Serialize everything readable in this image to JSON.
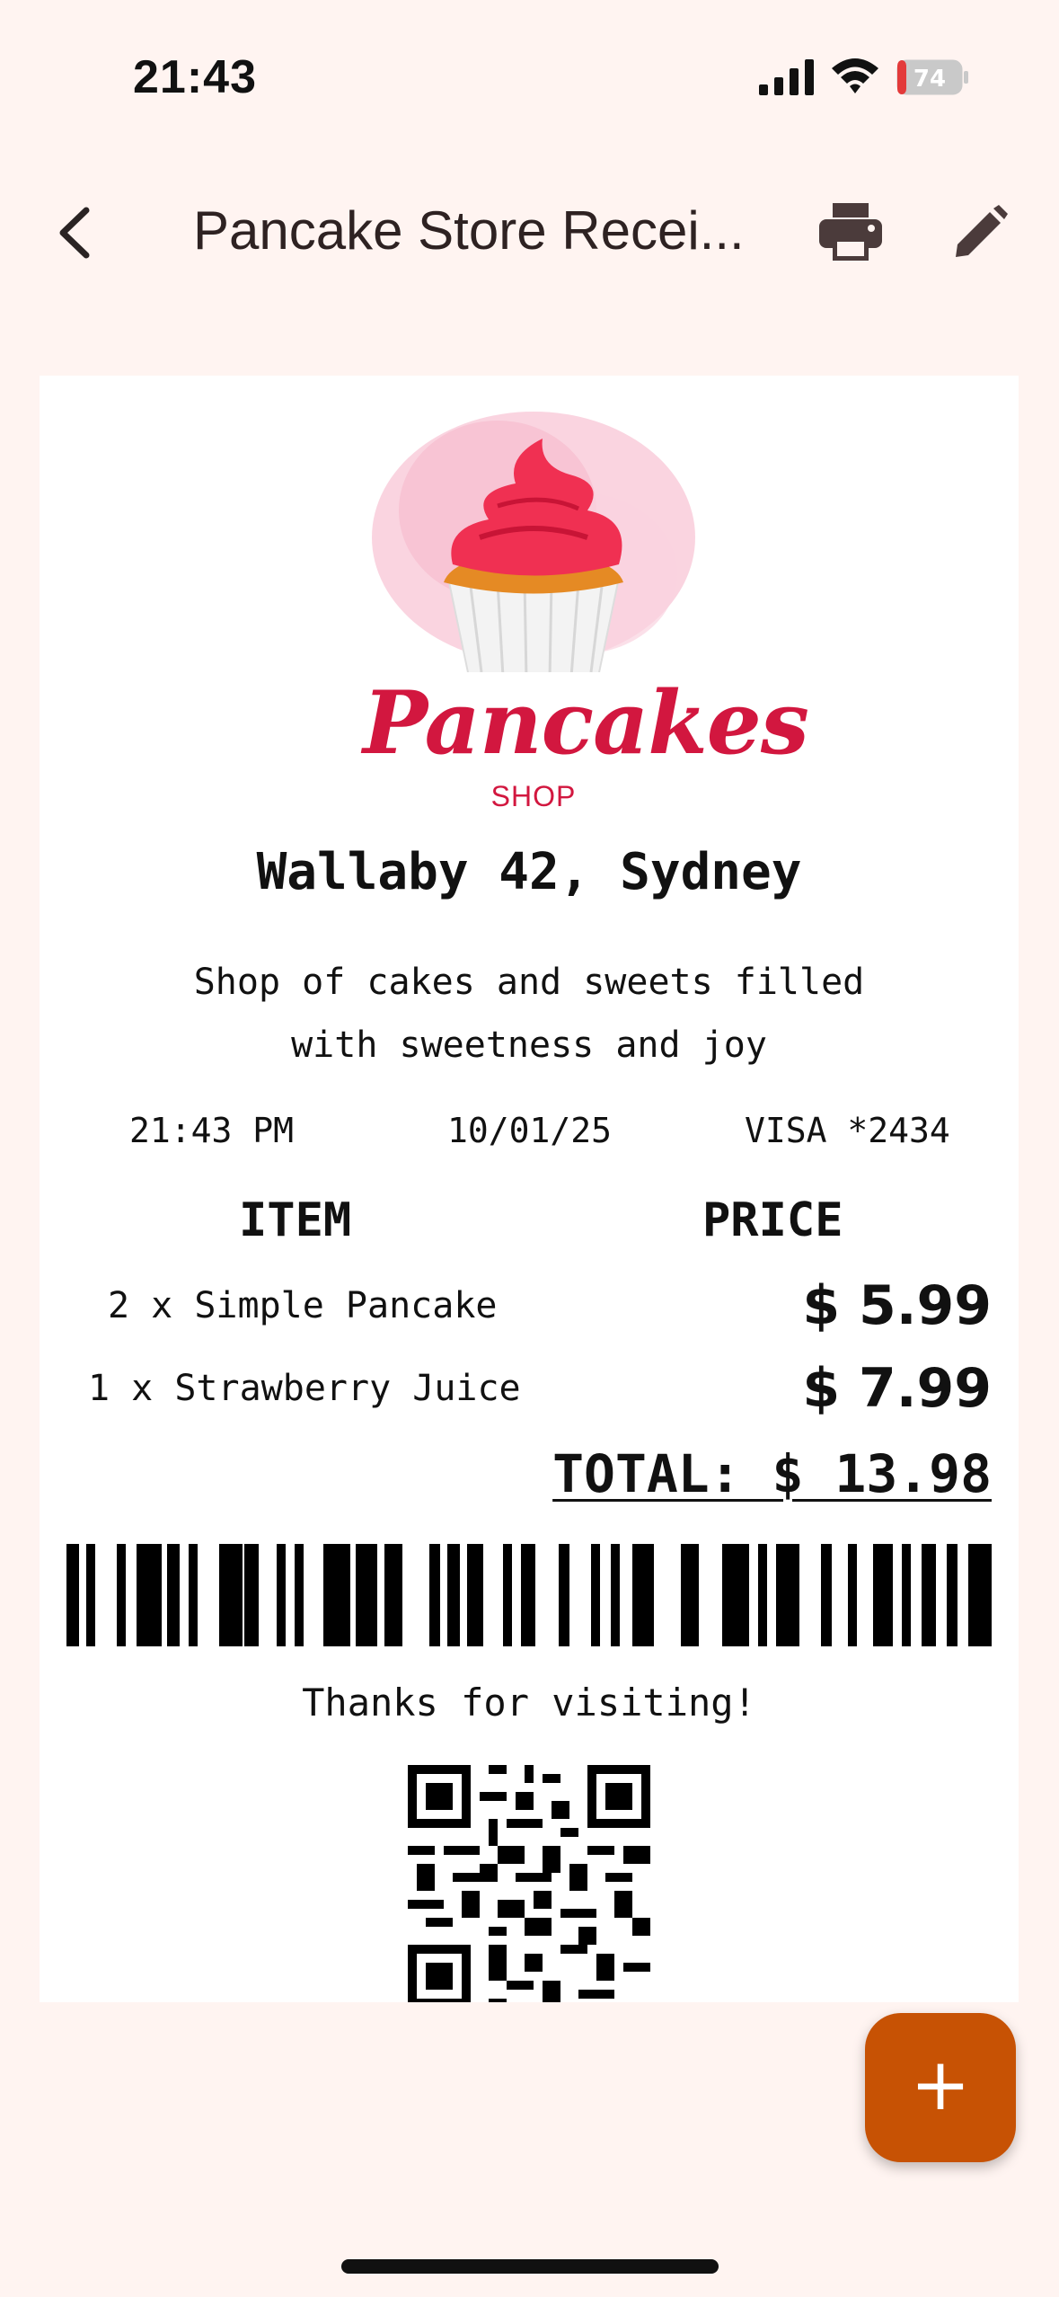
{
  "status_bar": {
    "time": "21:43",
    "battery_level": "74",
    "icons": [
      "signal-icon",
      "wifi-icon",
      "battery-icon"
    ]
  },
  "top_bar": {
    "title": "Pancake Store Recei...",
    "icons": [
      "back-arrow-icon",
      "printer-icon",
      "pencil-icon"
    ]
  },
  "receipt": {
    "logo": {
      "name": "Pancakes",
      "sub": "SHOP",
      "icon": "cupcake-icon"
    },
    "address": "Wallaby 42, Sydney",
    "tagline_line1": "Shop of cakes and sweets filled",
    "tagline_line2": "with sweetness and joy",
    "time": "21:43 PM",
    "date": "10/01/25",
    "card": "VISA *2434",
    "headers": {
      "item": "ITEM",
      "price": "PRICE"
    },
    "items": [
      {
        "label": "2 x Simple Pancake",
        "price": "$ 5.99"
      },
      {
        "label": "1 x Strawberry Juice",
        "price": "$ 7.99"
      }
    ],
    "total": "TOTAL: $ 13.98",
    "thanks": "Thanks for visiting!"
  },
  "fab": {
    "label": "+"
  },
  "colors": {
    "background": "#FFF4F1",
    "accent": "#C75204",
    "brand": "#D2173F"
  }
}
